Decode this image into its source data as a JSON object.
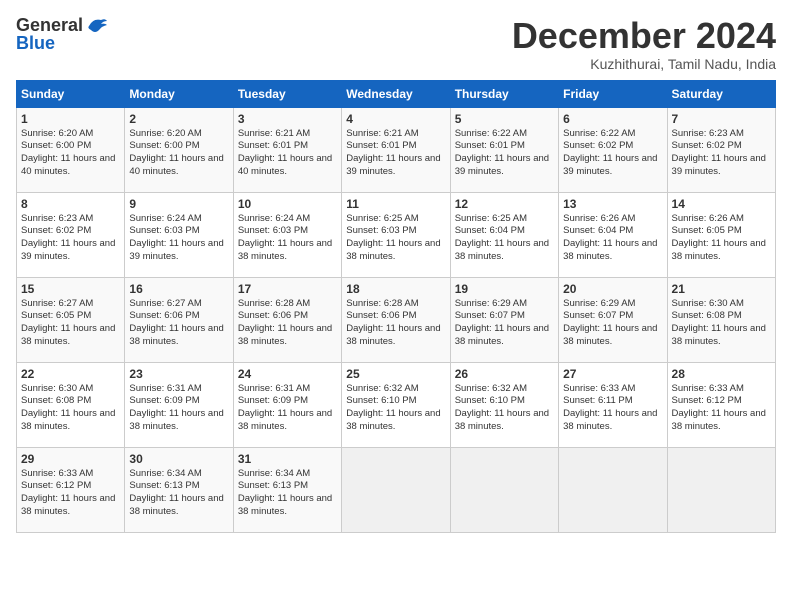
{
  "header": {
    "logo_general": "General",
    "logo_blue": "Blue",
    "month_title": "December 2024",
    "subtitle": "Kuzhithurai, Tamil Nadu, India"
  },
  "weekdays": [
    "Sunday",
    "Monday",
    "Tuesday",
    "Wednesday",
    "Thursday",
    "Friday",
    "Saturday"
  ],
  "weeks": [
    [
      {
        "day": "1",
        "sunrise": "6:20 AM",
        "sunset": "6:00 PM",
        "daylight": "11 hours and 40 minutes."
      },
      {
        "day": "2",
        "sunrise": "6:20 AM",
        "sunset": "6:00 PM",
        "daylight": "11 hours and 40 minutes."
      },
      {
        "day": "3",
        "sunrise": "6:21 AM",
        "sunset": "6:01 PM",
        "daylight": "11 hours and 40 minutes."
      },
      {
        "day": "4",
        "sunrise": "6:21 AM",
        "sunset": "6:01 PM",
        "daylight": "11 hours and 39 minutes."
      },
      {
        "day": "5",
        "sunrise": "6:22 AM",
        "sunset": "6:01 PM",
        "daylight": "11 hours and 39 minutes."
      },
      {
        "day": "6",
        "sunrise": "6:22 AM",
        "sunset": "6:02 PM",
        "daylight": "11 hours and 39 minutes."
      },
      {
        "day": "7",
        "sunrise": "6:23 AM",
        "sunset": "6:02 PM",
        "daylight": "11 hours and 39 minutes."
      }
    ],
    [
      {
        "day": "8",
        "sunrise": "6:23 AM",
        "sunset": "6:02 PM",
        "daylight": "11 hours and 39 minutes."
      },
      {
        "day": "9",
        "sunrise": "6:24 AM",
        "sunset": "6:03 PM",
        "daylight": "11 hours and 39 minutes."
      },
      {
        "day": "10",
        "sunrise": "6:24 AM",
        "sunset": "6:03 PM",
        "daylight": "11 hours and 38 minutes."
      },
      {
        "day": "11",
        "sunrise": "6:25 AM",
        "sunset": "6:03 PM",
        "daylight": "11 hours and 38 minutes."
      },
      {
        "day": "12",
        "sunrise": "6:25 AM",
        "sunset": "6:04 PM",
        "daylight": "11 hours and 38 minutes."
      },
      {
        "day": "13",
        "sunrise": "6:26 AM",
        "sunset": "6:04 PM",
        "daylight": "11 hours and 38 minutes."
      },
      {
        "day": "14",
        "sunrise": "6:26 AM",
        "sunset": "6:05 PM",
        "daylight": "11 hours and 38 minutes."
      }
    ],
    [
      {
        "day": "15",
        "sunrise": "6:27 AM",
        "sunset": "6:05 PM",
        "daylight": "11 hours and 38 minutes."
      },
      {
        "day": "16",
        "sunrise": "6:27 AM",
        "sunset": "6:06 PM",
        "daylight": "11 hours and 38 minutes."
      },
      {
        "day": "17",
        "sunrise": "6:28 AM",
        "sunset": "6:06 PM",
        "daylight": "11 hours and 38 minutes."
      },
      {
        "day": "18",
        "sunrise": "6:28 AM",
        "sunset": "6:06 PM",
        "daylight": "11 hours and 38 minutes."
      },
      {
        "day": "19",
        "sunrise": "6:29 AM",
        "sunset": "6:07 PM",
        "daylight": "11 hours and 38 minutes."
      },
      {
        "day": "20",
        "sunrise": "6:29 AM",
        "sunset": "6:07 PM",
        "daylight": "11 hours and 38 minutes."
      },
      {
        "day": "21",
        "sunrise": "6:30 AM",
        "sunset": "6:08 PM",
        "daylight": "11 hours and 38 minutes."
      }
    ],
    [
      {
        "day": "22",
        "sunrise": "6:30 AM",
        "sunset": "6:08 PM",
        "daylight": "11 hours and 38 minutes."
      },
      {
        "day": "23",
        "sunrise": "6:31 AM",
        "sunset": "6:09 PM",
        "daylight": "11 hours and 38 minutes."
      },
      {
        "day": "24",
        "sunrise": "6:31 AM",
        "sunset": "6:09 PM",
        "daylight": "11 hours and 38 minutes."
      },
      {
        "day": "25",
        "sunrise": "6:32 AM",
        "sunset": "6:10 PM",
        "daylight": "11 hours and 38 minutes."
      },
      {
        "day": "26",
        "sunrise": "6:32 AM",
        "sunset": "6:10 PM",
        "daylight": "11 hours and 38 minutes."
      },
      {
        "day": "27",
        "sunrise": "6:33 AM",
        "sunset": "6:11 PM",
        "daylight": "11 hours and 38 minutes."
      },
      {
        "day": "28",
        "sunrise": "6:33 AM",
        "sunset": "6:12 PM",
        "daylight": "11 hours and 38 minutes."
      }
    ],
    [
      {
        "day": "29",
        "sunrise": "6:33 AM",
        "sunset": "6:12 PM",
        "daylight": "11 hours and 38 minutes."
      },
      {
        "day": "30",
        "sunrise": "6:34 AM",
        "sunset": "6:13 PM",
        "daylight": "11 hours and 38 minutes."
      },
      {
        "day": "31",
        "sunrise": "6:34 AM",
        "sunset": "6:13 PM",
        "daylight": "11 hours and 38 minutes."
      },
      null,
      null,
      null,
      null
    ]
  ]
}
